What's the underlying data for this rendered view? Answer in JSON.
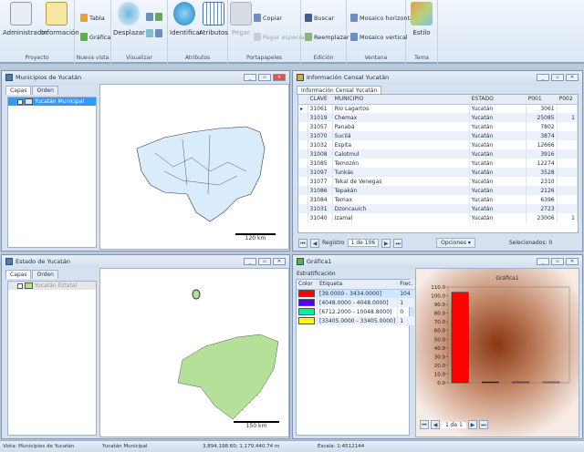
{
  "ribbon": {
    "groups": [
      {
        "label": "Proyecto"
      },
      {
        "label": "Nueva vista"
      },
      {
        "label": "Visualizar"
      },
      {
        "label": "Atributos"
      },
      {
        "label": "Portapapeles"
      },
      {
        "label": "Edición"
      },
      {
        "label": "Ventana"
      },
      {
        "label": "Tema"
      }
    ],
    "administrador": "Administrador",
    "informacion": "Información",
    "tabla": "Tabla",
    "grafica": "Gráfica",
    "desplazar": "Desplazar",
    "identificar": "Identificar",
    "atributos": "Atributos",
    "pegar": "Pegar",
    "copiar": "Copiar",
    "pegar_especial": "Pegar especial",
    "buscar": "Buscar",
    "reemplazar": "Reemplazar",
    "mosaico_h": "Mosaico horizontal",
    "mosaico_v": "Mosaico vertical",
    "estilo": "Estilo"
  },
  "win_municipios": {
    "title": "Municipios de Yucatán",
    "tabs": [
      "Capas",
      "Orden"
    ],
    "layer": "Yucatán Municipal",
    "scale": "120 km"
  },
  "win_estado": {
    "title": "Estado de Yucatán",
    "tabs": [
      "Capas",
      "Orden"
    ],
    "layer": "Yucatán Estatal",
    "scale": "150 km"
  },
  "win_censo": {
    "title": "Información Censal Yucatán",
    "tab": "Información Censal Yucatán",
    "columns": [
      "CLAVE",
      "MUNICIPIO",
      "ESTADO",
      "P001",
      "P002"
    ],
    "rows": [
      [
        "31061",
        "Río Lagartos",
        "Yucatán",
        "3061",
        ""
      ],
      [
        "31019",
        "Chemax",
        "Yucatán",
        "25085",
        "1"
      ],
      [
        "31057",
        "Panabá",
        "Yucatán",
        "7802",
        ""
      ],
      [
        "31070",
        "Sucilá",
        "Yucatán",
        "3874",
        ""
      ],
      [
        "31032",
        "Espita",
        "Yucatán",
        "12666",
        ""
      ],
      [
        "31008",
        "Calotmul",
        "Yucatán",
        "3916",
        ""
      ],
      [
        "31085",
        "Temozón",
        "Yucatán",
        "12274",
        ""
      ],
      [
        "31097",
        "Tunkás",
        "Yucatán",
        "3528",
        ""
      ],
      [
        "31077",
        "Tekal de Venegas",
        "Yucatán",
        "2310",
        ""
      ],
      [
        "31086",
        "Tepakán",
        "Yucatán",
        "2126",
        ""
      ],
      [
        "31084",
        "Temax",
        "Yucatán",
        "6396",
        ""
      ],
      [
        "31031",
        "Dzoncauich",
        "Yucatán",
        "2723",
        ""
      ],
      [
        "31040",
        "Izamal",
        "Yucatán",
        "23006",
        "1"
      ]
    ],
    "registro_label": "Registro",
    "registro": "1 de 106",
    "opciones": "Opciones",
    "seleccionados": "Selecionados: 0"
  },
  "win_grafica": {
    "title": "Gráfica1",
    "estratificacion": "Estratificación",
    "columns": [
      "Color",
      "Etiqueta",
      "Frec."
    ],
    "strata": [
      {
        "color": "#ff0000",
        "label": "[39.0000 - 3434.0000]",
        "freq": "104"
      },
      {
        "color": "#5500ff",
        "label": "[4048.0000 - 4048.0000]",
        "freq": "1"
      },
      {
        "color": "#00f0a0",
        "label": "[6712.2000 - 10048.8000]",
        "freq": "0"
      },
      {
        "color": "#ffff00",
        "label": "[33405.0000 - 33405.0000]",
        "freq": "1"
      }
    ],
    "page": "1 de 1"
  },
  "chart_data": {
    "type": "bar",
    "title": "Gráfica1",
    "categories": [
      "[39.0000 - 3434.0000]",
      "[4048.0000 - 4048.0000]",
      "[6712.2000 - 10048.8000]",
      "[33405.0000 - 33405.0000]"
    ],
    "values": [
      104,
      1,
      0,
      1
    ],
    "colors": [
      "#ff0000",
      "#3300cc",
      "#00c080",
      "#cccc00"
    ],
    "ylim": [
      0,
      110
    ],
    "yticks": [
      "0.0",
      "10.0",
      "20.0",
      "30.0",
      "40.0",
      "50.0",
      "60.0",
      "70.0",
      "80.0",
      "90.0",
      "100.0",
      "110.0"
    ]
  },
  "status": {
    "vista": "Vista: Municipios de Yucatán",
    "capa": "Yucatán Municipal",
    "coords": "3,894,198.60; 1,179,440.74 m",
    "escala": "Escala: 1:4512144"
  }
}
